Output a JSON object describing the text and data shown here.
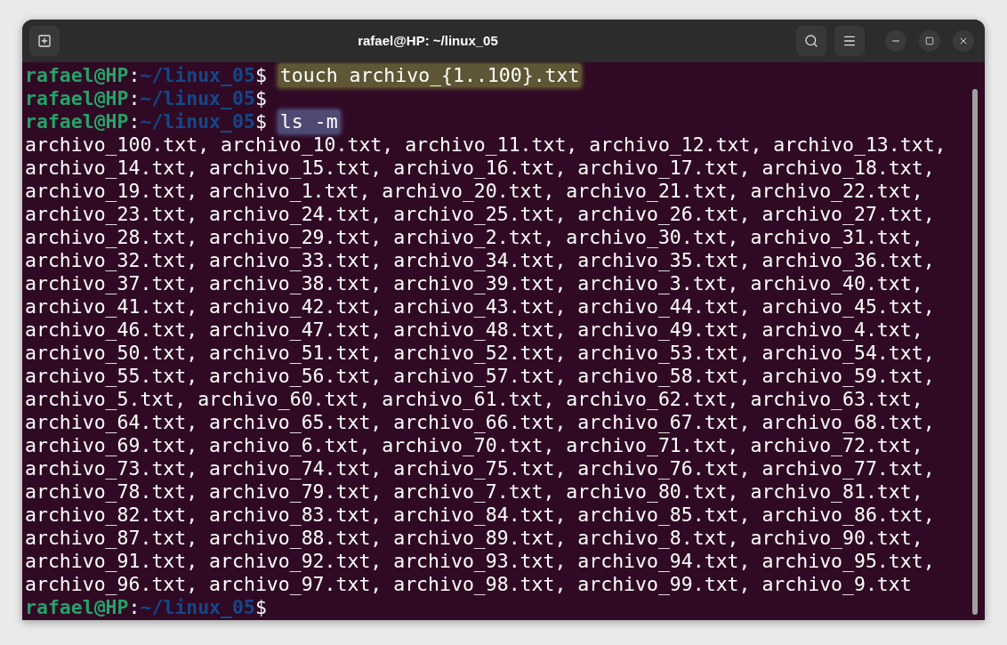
{
  "window": {
    "title": "rafael@HP: ~/linux_05"
  },
  "lines": [
    {
      "kind": "prompt",
      "user": "rafael@HP",
      "separator": ":",
      "path": "~/linux_05",
      "symbol": "$",
      "command": "touch archivo_{1..100}.txt",
      "color": "#5e5634"
    },
    {
      "kind": "prompt",
      "user": "rafael@HP",
      "separator": ":",
      "path": "~/linux_05",
      "symbol": "$"
    },
    {
      "kind": "prompt",
      "user": "rafael@HP",
      "separator": ":",
      "path": "~/linux_05",
      "symbol": "$",
      "command": "ls -m",
      "color": "#4e4a73"
    },
    {
      "kind": "output",
      "text": "archivo_100.txt, archivo_10.txt, archivo_11.txt, archivo_12.txt, archivo_13.txt,"
    },
    {
      "kind": "output",
      "text": "archivo_14.txt, archivo_15.txt, archivo_16.txt, archivo_17.txt, archivo_18.txt,"
    },
    {
      "kind": "output",
      "text": "archivo_19.txt, archivo_1.txt, archivo_20.txt, archivo_21.txt, archivo_22.txt,"
    },
    {
      "kind": "output",
      "text": "archivo_23.txt, archivo_24.txt, archivo_25.txt, archivo_26.txt, archivo_27.txt,"
    },
    {
      "kind": "output",
      "text": "archivo_28.txt, archivo_29.txt, archivo_2.txt, archivo_30.txt, archivo_31.txt,"
    },
    {
      "kind": "output",
      "text": "archivo_32.txt, archivo_33.txt, archivo_34.txt, archivo_35.txt, archivo_36.txt,"
    },
    {
      "kind": "output",
      "text": "archivo_37.txt, archivo_38.txt, archivo_39.txt, archivo_3.txt, archivo_40.txt,"
    },
    {
      "kind": "output",
      "text": "archivo_41.txt, archivo_42.txt, archivo_43.txt, archivo_44.txt, archivo_45.txt,"
    },
    {
      "kind": "output",
      "text": "archivo_46.txt, archivo_47.txt, archivo_48.txt, archivo_49.txt, archivo_4.txt,"
    },
    {
      "kind": "output",
      "text": "archivo_50.txt, archivo_51.txt, archivo_52.txt, archivo_53.txt, archivo_54.txt,"
    },
    {
      "kind": "output",
      "text": "archivo_55.txt, archivo_56.txt, archivo_57.txt, archivo_58.txt, archivo_59.txt,"
    },
    {
      "kind": "output",
      "text": "archivo_5.txt, archivo_60.txt, archivo_61.txt, archivo_62.txt, archivo_63.txt,"
    },
    {
      "kind": "output",
      "text": "archivo_64.txt, archivo_65.txt, archivo_66.txt, archivo_67.txt, archivo_68.txt,"
    },
    {
      "kind": "output",
      "text": "archivo_69.txt, archivo_6.txt, archivo_70.txt, archivo_71.txt, archivo_72.txt,"
    },
    {
      "kind": "output",
      "text": "archivo_73.txt, archivo_74.txt, archivo_75.txt, archivo_76.txt, archivo_77.txt,"
    },
    {
      "kind": "output",
      "text": "archivo_78.txt, archivo_79.txt, archivo_7.txt, archivo_80.txt, archivo_81.txt,"
    },
    {
      "kind": "output",
      "text": "archivo_82.txt, archivo_83.txt, archivo_84.txt, archivo_85.txt, archivo_86.txt,"
    },
    {
      "kind": "output",
      "text": "archivo_87.txt, archivo_88.txt, archivo_89.txt, archivo_8.txt, archivo_90.txt,"
    },
    {
      "kind": "output",
      "text": "archivo_91.txt, archivo_92.txt, archivo_93.txt, archivo_94.txt, archivo_95.txt,"
    },
    {
      "kind": "output",
      "text": "archivo_96.txt, archivo_97.txt, archivo_98.txt, archivo_99.txt, archivo_9.txt"
    },
    {
      "kind": "prompt",
      "user": "rafael@HP",
      "separator": ":",
      "path": "~/linux_05",
      "symbol": "$"
    }
  ]
}
